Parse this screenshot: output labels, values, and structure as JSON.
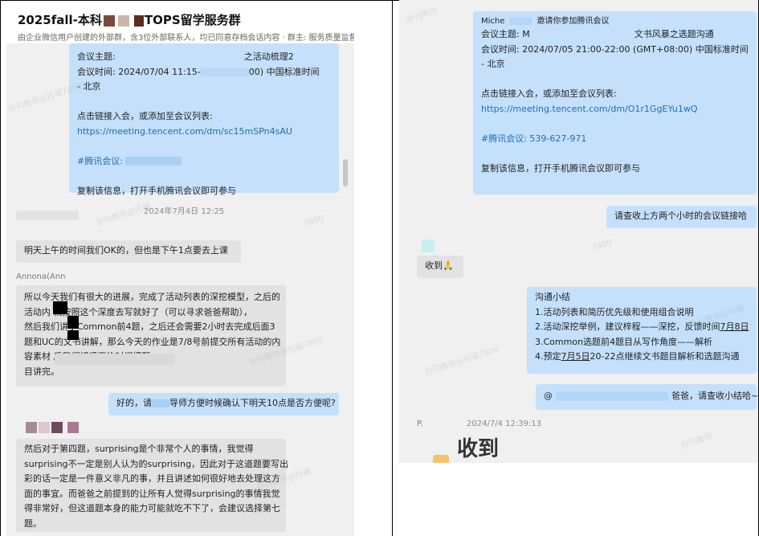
{
  "left": {
    "header": {
      "title_prefix": "2025fall-本科",
      "title_suffix": "TOPS留学服务群",
      "subtitle": "由企业微信用户创建的外部群，含3位外部联系人，均已同意存档会话内容 · 群主: 服务质量监督(..."
    },
    "meeting1": {
      "topic_label": "会议主题:",
      "topic_tail": "之活动梳理2",
      "time_label": "会议时间: 2024/07/04 11:15-",
      "time_tail": "00) 中国标准时间",
      "time_zone": "- 北京",
      "join_text": "点击链接入会，或添加至会议列表:",
      "link": "https://meeting.tencent.com/dm/sc15mSPn4sAU",
      "meeting_id_label": "#腾讯会议:",
      "copy_tip": "复制该信息，打开手机腾讯会议即可参与"
    },
    "timestamp1": "2024年7月4日 12:25",
    "msg_ok": "明天上午的时间我们OK的，但也是下午1点要去上课",
    "sender_annona": "Annona(Ann",
    "msg_progress": [
      "所以今天我们有很大的进展，完成了活动列表的深挖模型，之后的",
      "活动内        就按照这个深度去写就好了（可以寻求爸爸帮助），",
      "然后我们讲了Common前4题，之后还会需要2小时去完成后面3",
      "题和UC的文书讲解，那么今天的作业是7/8号前提交所有活动的内",
      "容素材                              后我们抓紧再约时间把题",
      "目讲完。"
    ],
    "msg_confirm_a": "好的，请",
    "msg_confirm_b": "导师方便时候确认下明天10点是否方便呢?",
    "msg_fourth": [
      "然后对于第四题，surprising是个非常个人的事情，我觉得",
      "surprising不一定是别人认为的surprising，因此对于这道题要写出",
      "彩的话一定是一件意义非凡的事，并且讲述如何很好地去处理这方",
      "面的事宜。而爸爸之前提到的让所有人觉得surprising的事情我觉",
      "得非常好，但这道题本身的能力可能就吃不下了，会建议选择第七",
      "题。"
    ],
    "watermarks": [
      "孙刊教师@托福7800",
      "孙刊教师@托福",
      "7800",
      "孙刊教师@托福7800",
      "孙刊教师@托福"
    ]
  },
  "right": {
    "meeting2": {
      "inviter": "Miche",
      "invite_text": "邀请你参加腾讯会议",
      "topic_label": "会议主题:",
      "topic_mid": "M",
      "topic_tail": "文书风暴之选题沟通",
      "time": "会议时间: 2024/07/05 21:00-22:00 (GMT+08:00) 中国标准时间",
      "time_zone": "- 北京",
      "join_text": "点击链接入会，或添加至会议列表:",
      "link": "https://meeting.tencent.com/dm/O1r1GgEYu1wQ",
      "meeting_id": "#腾讯会议: 539-627-971",
      "copy_tip": "复制该信息，打开手机腾讯会议即可参与"
    },
    "msg_check_links": "请查收上方两个小时的会议链接哈",
    "msg_received": "收到",
    "received_emoji": "🙏",
    "summary": {
      "title": "沟通小结",
      "items": [
        "1.活动列表和简历优先级和使用组合说明",
        "2.活动深挖举例，建议梓程——深挖，反馈时间",
        "3.Common选题前4题目从写作角度——解析",
        "4.预定",
        "20-22点继续文书题目解析和选题沟通"
      ],
      "date1": "7月8日",
      "date2": "7月5日"
    },
    "msg_at_prefix": "@",
    "msg_at_suffix": "爸爸，请查收小结哈~",
    "sender_p": "P.",
    "timestamp2": "2024/7/4 12:39:13",
    "sticker_text": "收到",
    "watermarks": [
      "孙刊教师",
      "7800",
      "孙刊教师@托福",
      "孙刊教师@托福7800",
      "孙刊教师"
    ]
  }
}
